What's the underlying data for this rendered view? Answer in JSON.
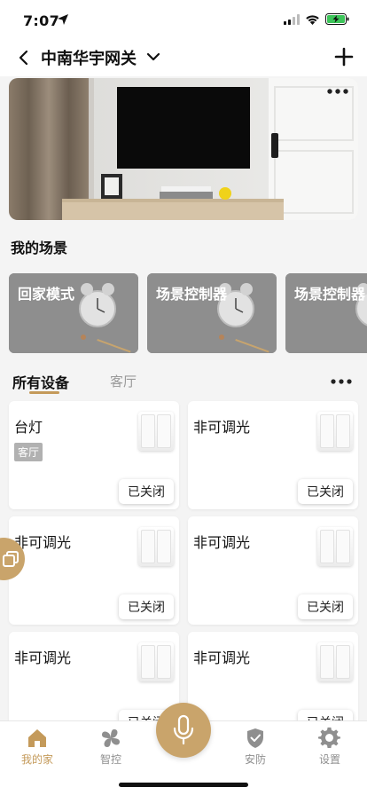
{
  "status_bar": {
    "time": "7:07"
  },
  "header": {
    "title": "中南华宇网关"
  },
  "sections": {
    "scenes_title": "我的场景"
  },
  "scenes": [
    {
      "label": "回家模式"
    },
    {
      "label": "场景控制器"
    },
    {
      "label": "场景控制器"
    }
  ],
  "device_tabs": {
    "active": "所有设备",
    "inactive": "客厅"
  },
  "devices": [
    {
      "name": "台灯",
      "room": "客厅",
      "state": "已关闭"
    },
    {
      "name": "非可调光",
      "state": "已关闭"
    },
    {
      "name": "非可调光",
      "state": "已关闭"
    },
    {
      "name": "非可调光",
      "state": "已关闭"
    },
    {
      "name": "非可调光",
      "state": "已关闭"
    },
    {
      "name": "非可调光",
      "state": "已关闭"
    }
  ],
  "bottom_nav": [
    {
      "label": "我的家",
      "icon": "home-icon",
      "active": true
    },
    {
      "label": "智控",
      "icon": "clover-icon",
      "active": false
    },
    {
      "label": "安防",
      "icon": "shield-icon",
      "active": false
    },
    {
      "label": "设置",
      "icon": "gear-icon",
      "active": false
    }
  ],
  "colors": {
    "accent": "#c49a5a",
    "mic": "#c9a46b",
    "inactive_nav": "#8f8f8f"
  }
}
